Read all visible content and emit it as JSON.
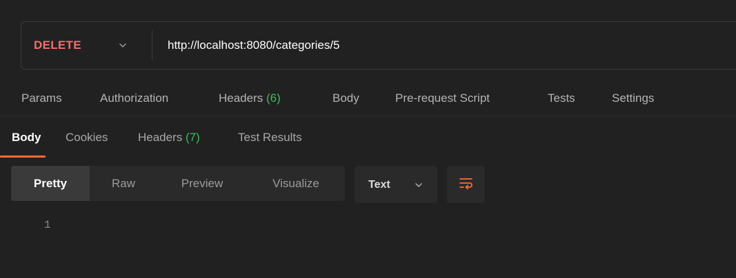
{
  "request": {
    "method": "DELETE",
    "method_color": "#f0706a",
    "url": "http://localhost:8080/categories/5"
  },
  "request_tabs": [
    {
      "label": "Params"
    },
    {
      "label": "Authorization"
    },
    {
      "label": "Headers",
      "count": "(6)"
    },
    {
      "label": "Body"
    },
    {
      "label": "Pre-request Script"
    },
    {
      "label": "Tests"
    },
    {
      "label": "Settings"
    }
  ],
  "response_tabs": [
    {
      "label": "Body",
      "active": true
    },
    {
      "label": "Cookies"
    },
    {
      "label": "Headers",
      "count": "(7)"
    },
    {
      "label": "Test Results"
    }
  ],
  "view_modes": [
    {
      "label": "Pretty",
      "selected": true
    },
    {
      "label": "Raw"
    },
    {
      "label": "Preview"
    },
    {
      "label": "Visualize"
    }
  ],
  "format": {
    "selected": "Text"
  },
  "editor": {
    "line_numbers": [
      "1"
    ]
  },
  "colors": {
    "accent": "#ff6c37",
    "count_green": "#3dbd5a",
    "background": "#212121"
  },
  "icons": {
    "method_dropdown": "chevron-down-icon",
    "format_dropdown": "chevron-down-icon",
    "wrap": "wrap-lines-icon"
  }
}
